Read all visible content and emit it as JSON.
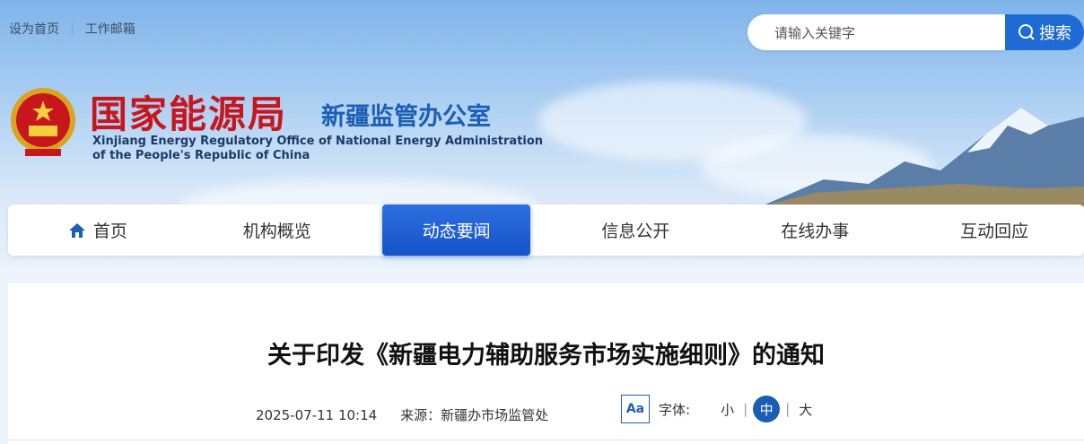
{
  "top_links": [
    "设为首页",
    "工作邮箱"
  ],
  "search": {
    "placeholder": "请输入关键字",
    "button_label": "搜索"
  },
  "header": {
    "title_cn": "国家能源局",
    "subtitle_cn": "新疆监管办公室",
    "title_en_line1": "Xinjiang Energy Regulatory Office of National Energy Administration",
    "title_en_line2": "of the People's Republic of China"
  },
  "nav": [
    {
      "label": "首页",
      "icon": "home-icon"
    },
    {
      "label": "机构概览"
    },
    {
      "label": "动态要闻",
      "active": true
    },
    {
      "label": "信息公开"
    },
    {
      "label": "在线办事"
    },
    {
      "label": "互动回应"
    }
  ],
  "article": {
    "title": "关于印发《新疆电力辅助服务市场实施细则》的通知",
    "date": "2025-07-11 10:14",
    "source": "来源：新疆办市场监管处",
    "font_icon": "Aa",
    "font_label": "字体:",
    "font_small": "小",
    "font_medium": "中",
    "font_large": "大"
  },
  "colors": {
    "accent": "#1f6bd6",
    "title_red": "#c8161d",
    "nav_active": "#1453c8"
  }
}
